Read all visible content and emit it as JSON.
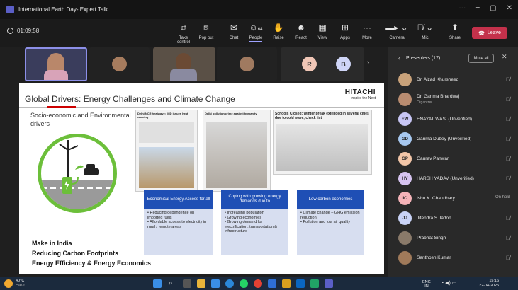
{
  "window": {
    "title": "International Earth Day- Expert Talk",
    "controls": [
      "···",
      "−",
      "▢",
      "✕"
    ]
  },
  "meeting": {
    "timer": "01:09:58",
    "buttons": [
      {
        "label": "Take control",
        "icon": "⧉"
      },
      {
        "label": "Pop out",
        "icon": "⧈"
      },
      {
        "label": "Chat",
        "icon": "✉"
      },
      {
        "label": "People",
        "icon": "☺",
        "badge": "64"
      },
      {
        "label": "Raise",
        "icon": "✋"
      },
      {
        "label": "React",
        "icon": "☻"
      },
      {
        "label": "View",
        "icon": "▦"
      },
      {
        "label": "Apps",
        "icon": "⊞"
      },
      {
        "label": "More",
        "icon": "···"
      }
    ],
    "camera_label": "Camera",
    "mic_label": "Mic",
    "share_label": "Share",
    "leave_label": "Leave"
  },
  "video_strip": {
    "avatars": [
      "R",
      "B"
    ]
  },
  "slide": {
    "title": "Global Drivers: Energy Challenges and Climate Change",
    "brand": "HITACHI",
    "brand_tagline": "Inspire the Next",
    "drivers_text": "Socio-economic and Environmental drivers",
    "news": [
      {
        "headline": "Delhi NCR heatwave: IMD issues heat warning"
      },
      {
        "headline": "Delhi pollution crime against humanity"
      },
      {
        "headline": "Schools Closed: Winter break extended in several cities due to cold wave; check list"
      }
    ],
    "boxes": [
      {
        "title": "Economical Energy Access for all",
        "items": [
          "Reducing dependence on imported fuels",
          "Affordable access to electricity in rural / remote areas"
        ]
      },
      {
        "title": "Coping with growing energy demands due to",
        "items": [
          "Increasing population",
          "Growing economies",
          "Growing demand for electrification, transportation & infrastructure"
        ]
      },
      {
        "title": "Low carbon economies",
        "items": [
          "Climate change – GHG emission reduction",
          "Pollution and low air quality"
        ]
      }
    ],
    "bottom_lines": [
      "Make in India",
      "Reducing Carbon Footprints",
      "Energy Efficiency & Energy Economics"
    ]
  },
  "panel": {
    "title": "Presenters (17)",
    "mute_all": "Mute all",
    "people": [
      {
        "name": "Dr. Aizad Khursheed",
        "initials": "",
        "color": "#c9a27a",
        "status": "muted"
      },
      {
        "name": "Dr. Garima Bhardwaj",
        "sub": "Organizer",
        "initials": "",
        "color": "#b98c70",
        "status": "muted"
      },
      {
        "name": "ENAYAT WASI (Unverified)",
        "initials": "EW",
        "color": "#c8c6f5",
        "status": "muted"
      },
      {
        "name": "Garima Dubey (Unverified)",
        "initials": "GD",
        "color": "#a7c8f0",
        "status": "muted"
      },
      {
        "name": "Gaurav Panwar",
        "initials": "GP",
        "color": "#f3c6a8",
        "status": "muted"
      },
      {
        "name": "HARSH YADAV (Unverified)",
        "initials": "HY",
        "color": "#d6c3f0",
        "status": "muted"
      },
      {
        "name": "Ishu K. Chaudhary",
        "initials": "IC",
        "color": "#f5b3b8",
        "status": "On hold"
      },
      {
        "name": "Jitendra S Jadon",
        "initials": "JJ",
        "color": "#c9d3f7",
        "status": "muted"
      },
      {
        "name": "Prabhat Singh",
        "initials": "",
        "color": "#8a7a6a",
        "status": "muted"
      },
      {
        "name": "Santhosh Kumar",
        "initials": "",
        "color": "#a07a5a",
        "status": "muted"
      }
    ]
  },
  "taskbar": {
    "weather_temp": "40°C",
    "weather_desc": "Haze",
    "lang": "ENG",
    "lang_sub": "IN",
    "time": "15:16",
    "date": "22-04-2025"
  }
}
